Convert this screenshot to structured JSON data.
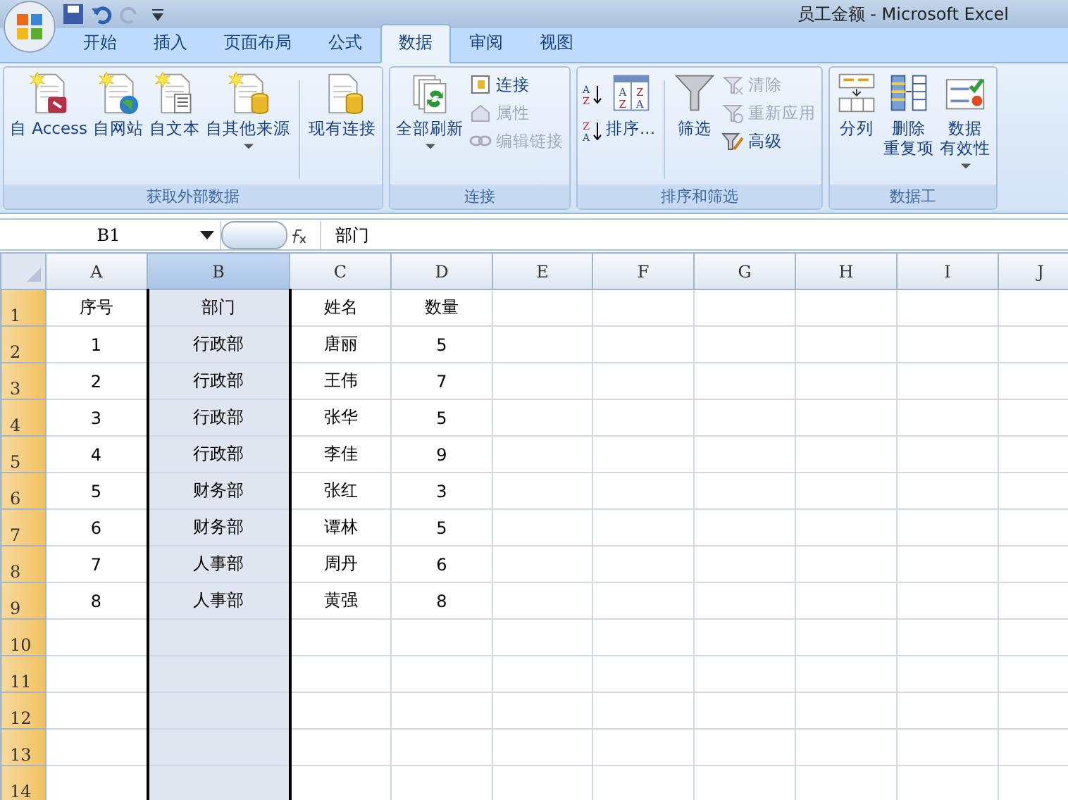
{
  "window": {
    "title": "员工金额 - Microsoft Excel"
  },
  "tabs": [
    {
      "label": "开始",
      "selected": false
    },
    {
      "label": "插入",
      "selected": false
    },
    {
      "label": "页面布局",
      "selected": false
    },
    {
      "label": "公式",
      "selected": false
    },
    {
      "label": "数据",
      "selected": true
    },
    {
      "label": "审阅",
      "selected": false
    },
    {
      "label": "视图",
      "selected": false
    }
  ],
  "ribbon": {
    "groups": [
      {
        "label": "获取外部数据",
        "items": [
          {
            "kind": "large",
            "label": "自 Access"
          },
          {
            "kind": "large",
            "label": "自网站"
          },
          {
            "kind": "large",
            "label": "自文本"
          },
          {
            "kind": "large",
            "label": "自其他来源",
            "dropdown": true
          },
          {
            "kind": "separator"
          },
          {
            "kind": "large",
            "label": "现有连接"
          }
        ]
      },
      {
        "label": "连接",
        "items": [
          {
            "kind": "large",
            "label": "全部刷新",
            "dropdown": true
          },
          {
            "kind": "stack",
            "items": [
              {
                "label": "连接",
                "disabled": false
              },
              {
                "label": "属性",
                "disabled": true
              },
              {
                "label": "编辑链接",
                "disabled": true
              }
            ]
          }
        ]
      },
      {
        "label": "排序和筛选",
        "items": [
          {
            "kind": "iconstack",
            "icons": [
              {
                "letters": [
                  "A",
                  "Z"
                ]
              },
              {
                "letters": [
                  "Z",
                  "A"
                ]
              }
            ]
          },
          {
            "kind": "large",
            "label": "排序...",
            "letters": [
              "A",
              "Z",
              "Z",
              "A"
            ]
          },
          {
            "kind": "separator"
          },
          {
            "kind": "large",
            "label": "筛选"
          },
          {
            "kind": "stack",
            "items": [
              {
                "label": "清除",
                "disabled": true
              },
              {
                "label": "重新应用",
                "disabled": true
              },
              {
                "label": "高级",
                "disabled": false
              }
            ]
          }
        ]
      },
      {
        "label": "数据工",
        "items": [
          {
            "kind": "large",
            "label": "分列"
          },
          {
            "kind": "large",
            "lines": [
              "删除",
              "重复项"
            ]
          },
          {
            "kind": "large",
            "lines": [
              "数据",
              "有效性"
            ],
            "dropdown": true
          }
        ]
      }
    ]
  },
  "formula_bar": {
    "name_box": "B1",
    "value": "部门"
  },
  "sheet": {
    "columns": [
      {
        "label": "A",
        "selected": false
      },
      {
        "label": "B",
        "selected": true
      },
      {
        "label": "C",
        "selected": false
      },
      {
        "label": "D",
        "selected": false
      },
      {
        "label": "E",
        "selected": false
      },
      {
        "label": "F",
        "selected": false
      },
      {
        "label": "G",
        "selected": false
      },
      {
        "label": "H",
        "selected": false
      },
      {
        "label": "I",
        "selected": false
      },
      {
        "label": "J",
        "selected": false
      }
    ],
    "rows": [
      {
        "label": "1",
        "cells": [
          "序号",
          "部门",
          "姓名",
          "数量"
        ]
      },
      {
        "label": "2",
        "cells": [
          "1",
          "行政部",
          "唐丽",
          "5"
        ]
      },
      {
        "label": "3",
        "cells": [
          "2",
          "行政部",
          "王伟",
          "7"
        ]
      },
      {
        "label": "4",
        "cells": [
          "3",
          "行政部",
          "张华",
          "5"
        ]
      },
      {
        "label": "5",
        "cells": [
          "4",
          "行政部",
          "李佳",
          "9"
        ]
      },
      {
        "label": "6",
        "cells": [
          "5",
          "财务部",
          "张红",
          "3"
        ]
      },
      {
        "label": "7",
        "cells": [
          "6",
          "财务部",
          "谭林",
          "5"
        ]
      },
      {
        "label": "8",
        "cells": [
          "7",
          "人事部",
          "周丹",
          "6"
        ]
      },
      {
        "label": "9",
        "cells": [
          "8",
          "人事部",
          "黄强",
          "8"
        ]
      },
      {
        "label": "10"
      },
      {
        "label": "11"
      },
      {
        "label": "12"
      },
      {
        "label": "13"
      },
      {
        "label": "14"
      }
    ]
  }
}
